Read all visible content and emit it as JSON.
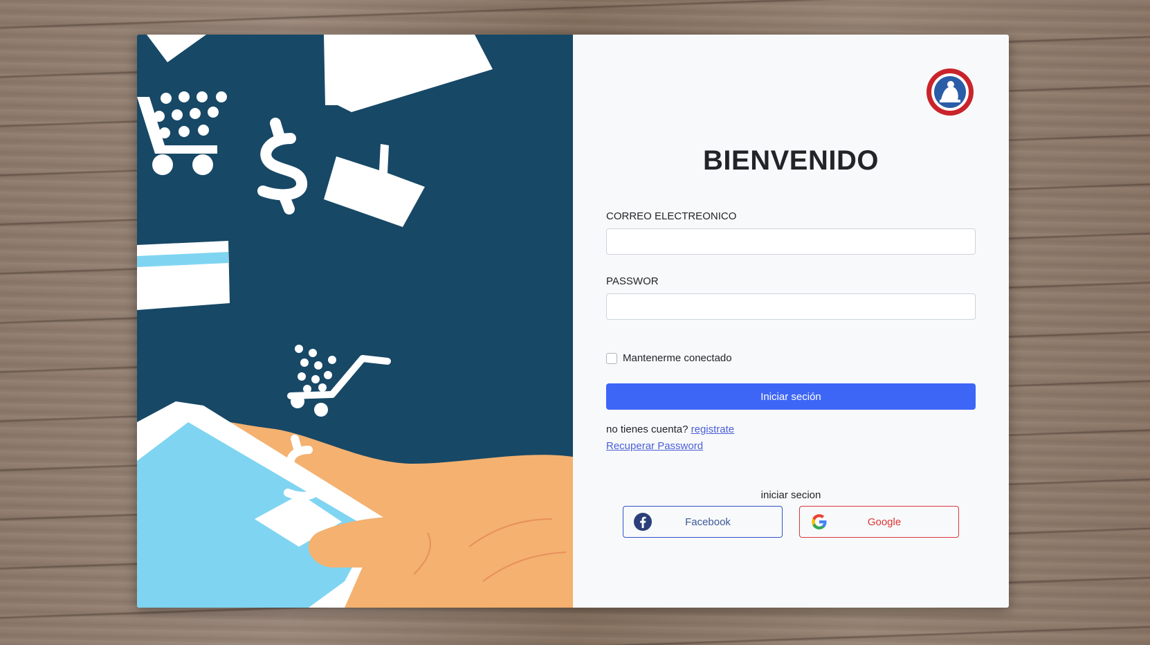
{
  "title": "BIENVENIDO",
  "form": {
    "email_label": "CORREO ELECTREONICO",
    "email_value": "",
    "password_label": "PASSWOR",
    "password_value": "",
    "remember_label": "Mantenerme conectado",
    "remember_checked": false,
    "submit_label": "Iniciar seción"
  },
  "links": {
    "signup_prompt": "no tienes cuenta?",
    "signup_link": "registrate",
    "recover_link": "Recuperar Password"
  },
  "social": {
    "heading": "iniciar secion",
    "facebook_label": "Facebook",
    "google_label": "Google"
  },
  "colors": {
    "left_panel_bg": "#174866",
    "primary_button": "#3d66f6",
    "facebook": "#2f52c8",
    "google": "#d9363e",
    "hand": "#f4b170",
    "phone_screen": "#7fd5f1"
  },
  "icons": {
    "logo": "university-seal-logo",
    "facebook": "facebook-icon",
    "google": "google-icon"
  }
}
